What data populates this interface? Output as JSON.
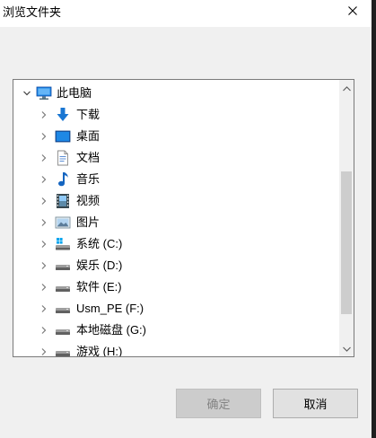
{
  "window": {
    "title": "浏览文件夹"
  },
  "tree": {
    "root": {
      "label": "此电脑",
      "icon": "computer-icon",
      "expanded": true
    },
    "items": [
      {
        "label": "下载",
        "icon": "downloads-icon"
      },
      {
        "label": "桌面",
        "icon": "desktop-icon"
      },
      {
        "label": "文档",
        "icon": "documents-icon"
      },
      {
        "label": "音乐",
        "icon": "music-icon"
      },
      {
        "label": "视频",
        "icon": "videos-icon"
      },
      {
        "label": "图片",
        "icon": "pictures-icon"
      },
      {
        "label": "系统 (C:)",
        "icon": "system-drive-icon"
      },
      {
        "label": "娱乐 (D:)",
        "icon": "drive-icon"
      },
      {
        "label": "软件 (E:)",
        "icon": "drive-icon"
      },
      {
        "label": "Usm_PE (F:)",
        "icon": "drive-icon"
      },
      {
        "label": "本地磁盘 (G:)",
        "icon": "drive-icon"
      },
      {
        "label": "游戏 (H:)",
        "icon": "drive-icon"
      }
    ]
  },
  "buttons": {
    "ok_label": "确定",
    "ok_enabled": false,
    "cancel_label": "取消"
  },
  "colors": {
    "dialog_bg": "#f0f0f0",
    "tree_bg": "#ffffff",
    "computer_blue": "#1e88e5",
    "download_blue": "#1976d2",
    "music_blue": "#1565c0",
    "disabled_text": "#838383"
  }
}
